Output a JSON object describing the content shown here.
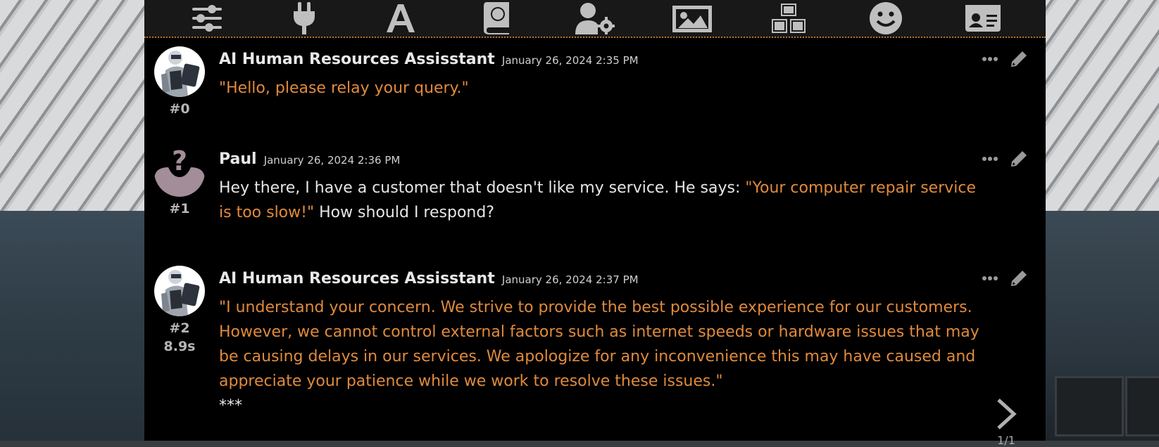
{
  "nav": {
    "icons": [
      "sliders-icon",
      "plug-icon",
      "font-icon",
      "book-globe-icon",
      "user-gear-icon",
      "image-icon",
      "cubes-icon",
      "smile-icon",
      "id-card-icon"
    ]
  },
  "colors": {
    "quote": "#e08a3c",
    "text": "#e6e6e6",
    "accent_border": "#b86e2a",
    "background": "#000000"
  },
  "messages": [
    {
      "name": "AI Human Resources Assisstant",
      "timestamp": "January 26, 2024 2:35 PM",
      "id": "#0",
      "segments": [
        {
          "text": "\"Hello, please relay your query.\"",
          "quote": true
        }
      ]
    },
    {
      "name": "Paul",
      "timestamp": "January 26, 2024 2:36 PM",
      "id": "#1",
      "segments": [
        {
          "text": "Hey there, I have a customer that doesn't like my service. He says: ",
          "quote": false
        },
        {
          "text": "\"Your computer repair service is too slow!\"",
          "quote": true
        },
        {
          "text": " How should I respond?",
          "quote": false
        }
      ]
    },
    {
      "name": "AI Human Resources Assisstant",
      "timestamp": "January 26, 2024 2:37 PM",
      "id": "#2",
      "timer": "8.9s",
      "segments": [
        {
          "text": "\"I understand your concern. We strive to provide the best possible experience for our customers. However, we cannot control external factors such as internet speeds or hardware issues that may be causing delays in our services. We apologize for any inconvenience this may have caused and appreciate your patience while we work to resolve these issues.\"",
          "quote": true
        }
      ],
      "extra_line": "***",
      "swipe_counter": "1/1"
    }
  ]
}
